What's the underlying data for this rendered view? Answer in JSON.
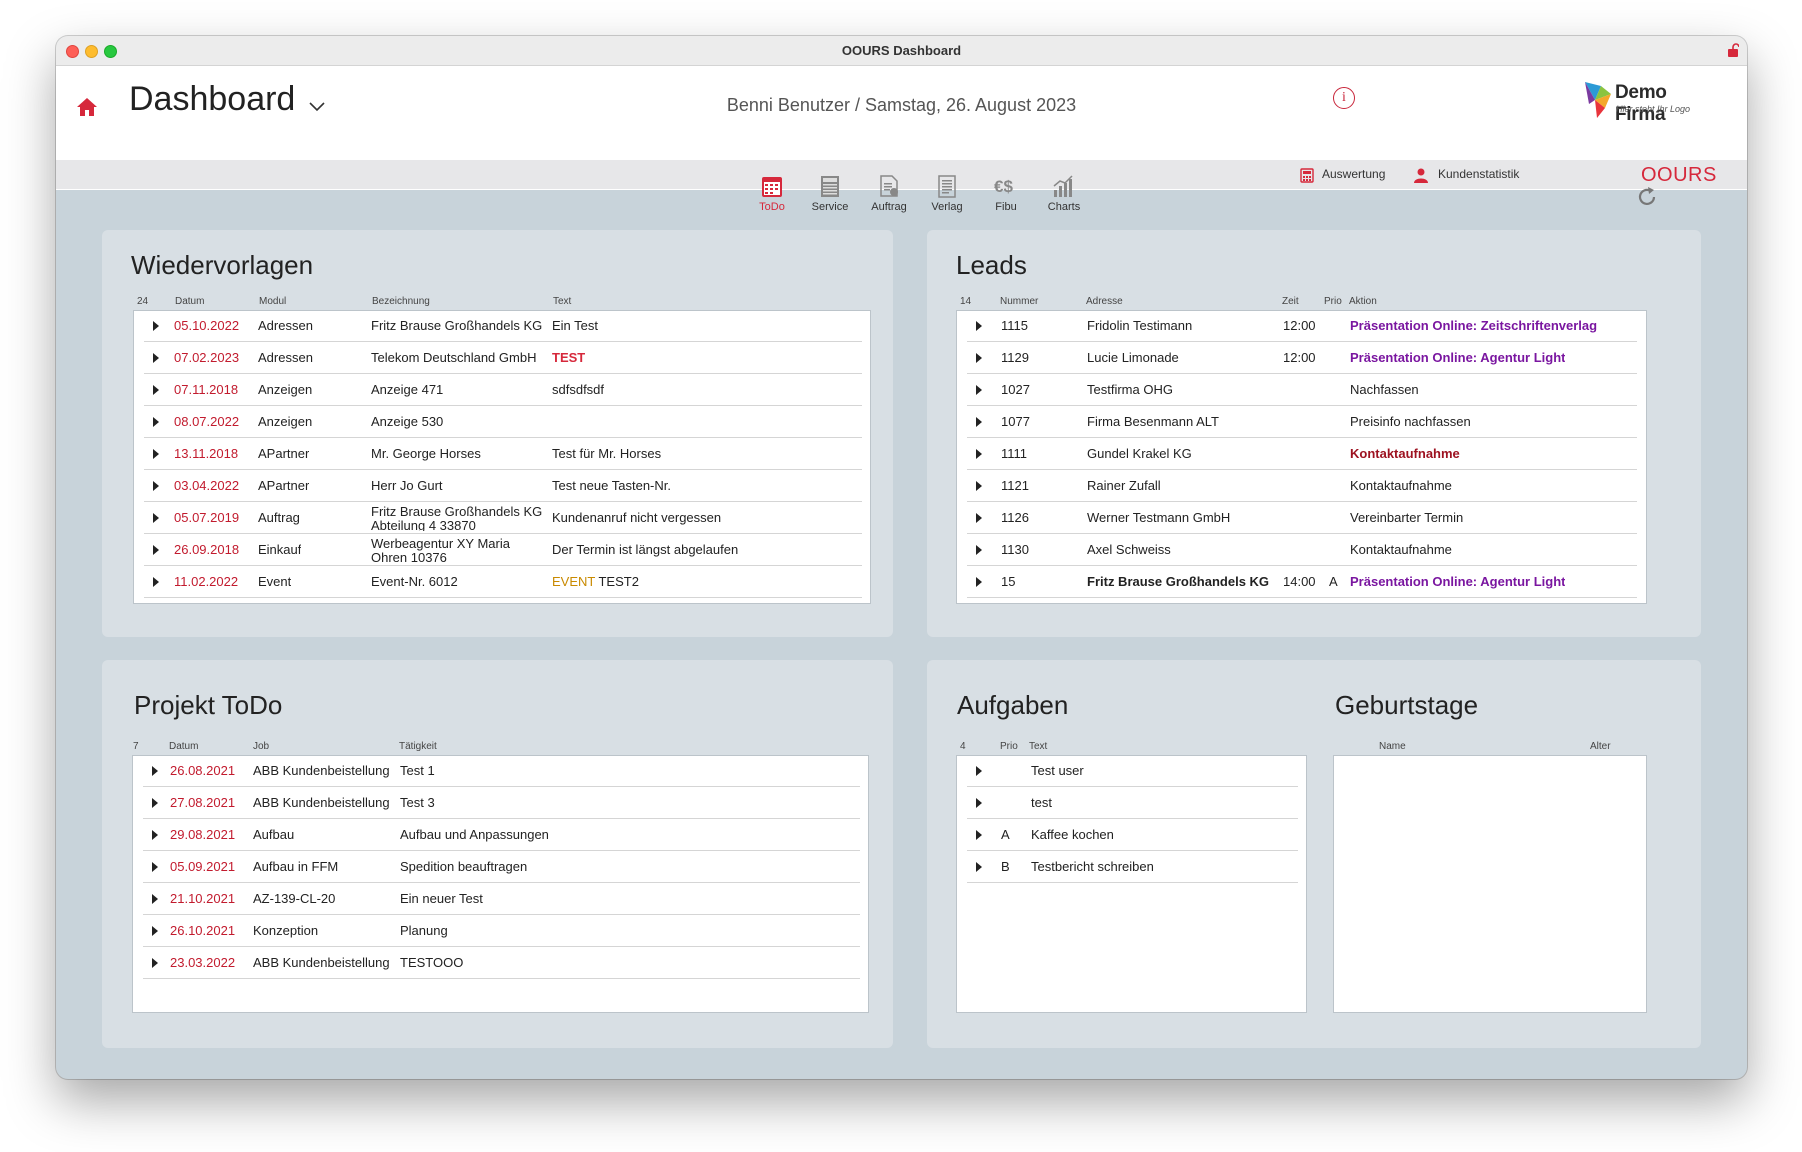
{
  "window": {
    "title": "OOURS Dashboard"
  },
  "header": {
    "title": "Dashboard",
    "user_date": "Benni Benutzer / Samstag, 26. August 2023",
    "info_icon": "i",
    "logo_name": "Demo Firma",
    "logo_sub": "Hier steht Ihr Logo"
  },
  "linkbar": {
    "auswertung": "Auswertung",
    "kundenstatistik": "Kundenstatistik",
    "brand": "OOURS"
  },
  "toolbar": {
    "items": [
      {
        "label": "ToDo",
        "icon": "calendar-icon",
        "active": true
      },
      {
        "label": "Service",
        "icon": "service-icon"
      },
      {
        "label": "Auftrag",
        "icon": "order-icon"
      },
      {
        "label": "Verlag",
        "icon": "publisher-icon"
      },
      {
        "label": "Fibu",
        "icon": "finance-icon"
      },
      {
        "label": "Charts",
        "icon": "charts-icon"
      }
    ]
  },
  "colors": {
    "accent": "#d6283b",
    "date_red": "#c21b2e",
    "action_purple": "#7a16a0"
  },
  "wiedervorlagen": {
    "title": "Wiedervorlagen",
    "count": "24",
    "columns": [
      "Datum",
      "Modul",
      "Bezeichnung",
      "Text"
    ],
    "rows": [
      {
        "datum": "05.10.2022",
        "modul": "Adressen",
        "bezeichnung": "Fritz Brause Großhandels KG",
        "text": "Ein Test"
      },
      {
        "datum": "07.02.2023",
        "modul": "Adressen",
        "bezeichnung": "Telekom Deutschland GmbH",
        "text": "TEST"
      },
      {
        "datum": "07.11.2018",
        "modul": "Anzeigen",
        "bezeichnung": "Anzeige 471",
        "text": "sdfsdfsdf"
      },
      {
        "datum": "08.07.2022",
        "modul": "Anzeigen",
        "bezeichnung": "Anzeige 530",
        "text": ""
      },
      {
        "datum": "13.11.2018",
        "modul": "APartner",
        "bezeichnung": "Mr. George Horses",
        "text": "Test für Mr. Horses"
      },
      {
        "datum": "03.04.2022",
        "modul": "APartner",
        "bezeichnung": "Herr Jo Gurt",
        "text": "Test neue Tasten-Nr."
      },
      {
        "datum": "05.07.2019",
        "modul": "Auftrag",
        "bezeichnung": "Fritz Brause Großhandels KG Abteilung 4 33870",
        "text": "Kundenanruf nicht vergessen"
      },
      {
        "datum": "26.09.2018",
        "modul": "Einkauf",
        "bezeichnung": "Werbeagentur XY Maria Ohren 10376",
        "text": "Der Termin ist längst abgelaufen"
      },
      {
        "datum": "11.02.2022",
        "modul": "Event",
        "bezeichnung": "Event-Nr. 6012",
        "text_a": "EVENT",
        "text_b": " TEST2"
      }
    ]
  },
  "leads": {
    "title": "Leads",
    "count": "14",
    "columns": [
      "Nummer",
      "Adresse",
      "Zeit",
      "Prio",
      "Aktion"
    ],
    "rows": [
      {
        "nummer": "1115",
        "adresse": "Fridolin Testimann",
        "zeit": "12:00",
        "prio": "",
        "aktion": "Präsentation Online: Zeitschriftenverlag"
      },
      {
        "nummer": "1129",
        "adresse": "Lucie Limonade",
        "zeit": "12:00",
        "prio": "",
        "aktion": "Präsentation Online: Agentur Light"
      },
      {
        "nummer": "1027",
        "adresse": "Testfirma OHG",
        "zeit": "",
        "prio": "",
        "aktion": "Nachfassen"
      },
      {
        "nummer": "1077",
        "adresse": "Firma Besenmann ALT",
        "zeit": "",
        "prio": "",
        "aktion": "Preisinfo nachfassen"
      },
      {
        "nummer": "1111",
        "adresse": "Gundel Krakel KG",
        "zeit": "",
        "prio": "",
        "aktion": "Kontaktaufnahme"
      },
      {
        "nummer": "1121",
        "adresse": "Rainer Zufall",
        "zeit": "",
        "prio": "",
        "aktion": "Kontaktaufnahme"
      },
      {
        "nummer": "1126",
        "adresse": "Werner Testmann GmbH",
        "zeit": "",
        "prio": "",
        "aktion": "Vereinbarter Termin"
      },
      {
        "nummer": "1130",
        "adresse": "Axel Schweiss",
        "zeit": "",
        "prio": "",
        "aktion": "Kontaktaufnahme"
      },
      {
        "nummer": "15",
        "adresse": "Fritz Brause Großhandels KG",
        "zeit": "14:00",
        "prio": "A",
        "aktion": "Präsentation Online: Agentur Light"
      }
    ]
  },
  "projekt": {
    "title": "Projekt ToDo",
    "count": "7",
    "columns": [
      "Datum",
      "Job",
      "Tätigkeit"
    ],
    "rows": [
      {
        "datum": "26.08.2021",
        "job": "ABB Kundenbeistellung",
        "taetigkeit": "Test 1"
      },
      {
        "datum": "27.08.2021",
        "job": "ABB Kundenbeistellung",
        "taetigkeit": "Test 3"
      },
      {
        "datum": "29.08.2021",
        "job": "Aufbau",
        "taetigkeit": "Aufbau und Anpassungen"
      },
      {
        "datum": "05.09.2021",
        "job": "Aufbau in FFM",
        "taetigkeit": "Spedition beauftragen"
      },
      {
        "datum": "21.10.2021",
        "job": "AZ-139-CL-20",
        "taetigkeit": "Ein neuer Test"
      },
      {
        "datum": "26.10.2021",
        "job": "Konzeption",
        "taetigkeit": "Planung"
      },
      {
        "datum": "23.03.2022",
        "job": "ABB Kundenbeistellung",
        "taetigkeit": "TESTOOO"
      }
    ]
  },
  "aufgaben": {
    "title": "Aufgaben",
    "count": "4",
    "columns": [
      "Prio",
      "Text"
    ],
    "rows": [
      {
        "prio": "",
        "text": "Test user"
      },
      {
        "prio": "",
        "text": "test"
      },
      {
        "prio": "A",
        "text": "Kaffee kochen"
      },
      {
        "prio": "B",
        "text": "Testbericht schreiben"
      }
    ]
  },
  "geburtstage": {
    "title": "Geburtstage",
    "columns": [
      "Name",
      "Alter"
    ]
  }
}
